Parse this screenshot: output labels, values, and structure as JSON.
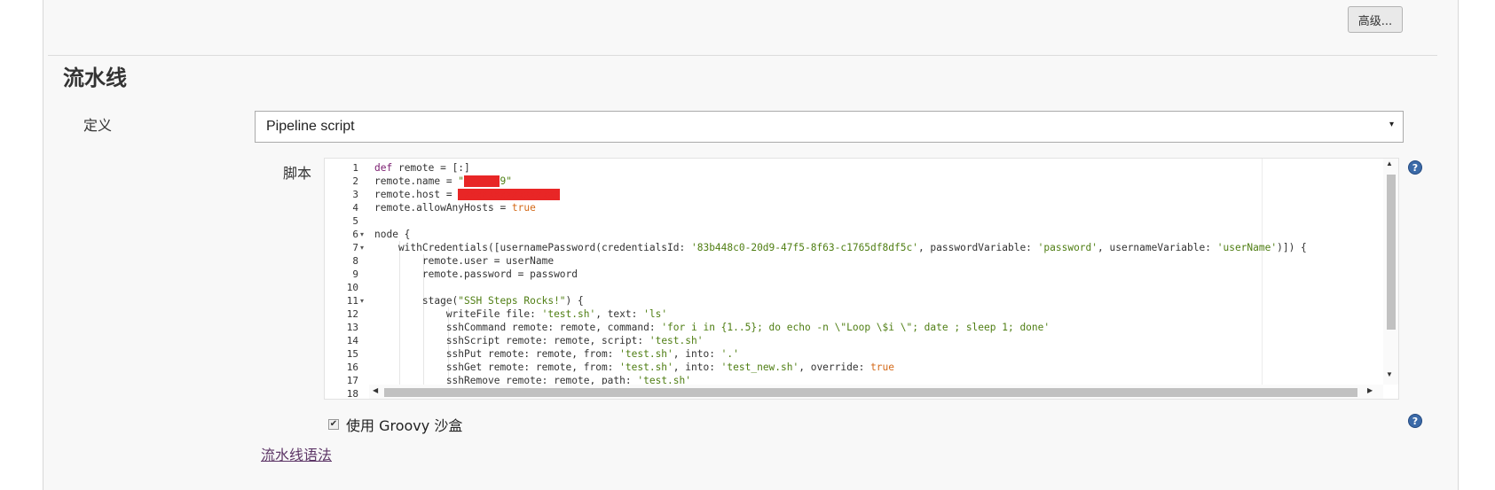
{
  "advanced_button": "高级...",
  "section": {
    "title": "流水线"
  },
  "definition": {
    "label": "定义",
    "selected": "Pipeline script",
    "arrow": "▾"
  },
  "script": {
    "label": "脚本",
    "line_numbers": [
      "1",
      "2",
      "3",
      "4",
      "5",
      "6",
      "7",
      "8",
      "9",
      "10",
      "11",
      "12",
      "13",
      "14",
      "15",
      "16",
      "17",
      "18"
    ],
    "folds": {
      "6": "▾",
      "7": "▾",
      "11": "▾"
    },
    "code": [
      [
        {
          "t": "def",
          "c": "kw"
        },
        {
          "t": " remote = [:]",
          "c": "op"
        }
      ],
      [
        {
          "t": "remote.name = ",
          "c": "op"
        },
        {
          "t": "\"",
          "c": "str"
        },
        {
          "t": "xxxxxx",
          "c": "red"
        },
        {
          "t": "9\"",
          "c": "str"
        }
      ],
      [
        {
          "t": "remote.host = ",
          "c": "op"
        },
        {
          "t": "'xxxxxxxxxxxxxxx'",
          "c": "red"
        }
      ],
      [
        {
          "t": "remote.allowAnyHosts = ",
          "c": "op"
        },
        {
          "t": "true",
          "c": "bool"
        }
      ],
      [],
      [
        {
          "t": "node {",
          "c": "op"
        }
      ],
      [
        {
          "t": "    withCredentials([usernamePassword(credentialsId: ",
          "c": "op"
        },
        {
          "t": "'83b448c0-20d9-47f5-8f63-c1765df8df5c'",
          "c": "str"
        },
        {
          "t": ", passwordVariable: ",
          "c": "op"
        },
        {
          "t": "'password'",
          "c": "str"
        },
        {
          "t": ", usernameVariable: ",
          "c": "op"
        },
        {
          "t": "'userName'",
          "c": "str"
        },
        {
          "t": ")]) {",
          "c": "op"
        }
      ],
      [
        {
          "t": "        remote.user = userName",
          "c": "op"
        }
      ],
      [
        {
          "t": "        remote.password = password",
          "c": "op"
        }
      ],
      [],
      [
        {
          "t": "        stage(",
          "c": "op"
        },
        {
          "t": "\"SSH Steps Rocks!\"",
          "c": "str"
        },
        {
          "t": ") {",
          "c": "op"
        }
      ],
      [
        {
          "t": "            writeFile file: ",
          "c": "op"
        },
        {
          "t": "'test.sh'",
          "c": "str"
        },
        {
          "t": ", text: ",
          "c": "op"
        },
        {
          "t": "'ls'",
          "c": "str"
        }
      ],
      [
        {
          "t": "            sshCommand remote: remote, command: ",
          "c": "op"
        },
        {
          "t": "'for i in {1..5}; do echo -n \\\"Loop \\$i \\\"; date ; sleep 1; done'",
          "c": "str"
        }
      ],
      [
        {
          "t": "            sshScript remote: remote, script: ",
          "c": "op"
        },
        {
          "t": "'test.sh'",
          "c": "str"
        }
      ],
      [
        {
          "t": "            sshPut remote: remote, from: ",
          "c": "op"
        },
        {
          "t": "'test.sh'",
          "c": "str"
        },
        {
          "t": ", into: ",
          "c": "op"
        },
        {
          "t": "'.'",
          "c": "str"
        }
      ],
      [
        {
          "t": "            sshGet remote: remote, from: ",
          "c": "op"
        },
        {
          "t": "'test.sh'",
          "c": "str"
        },
        {
          "t": ", into: ",
          "c": "op"
        },
        {
          "t": "'test_new.sh'",
          "c": "str"
        },
        {
          "t": ", override: ",
          "c": "op"
        },
        {
          "t": "true",
          "c": "bool"
        }
      ],
      [
        {
          "t": "            sshRemove remote: remote, path: ",
          "c": "op"
        },
        {
          "t": "'test.sh'",
          "c": "str"
        }
      ],
      []
    ]
  },
  "sandbox": {
    "label": "使用 Groovy 沙盒",
    "checked": true,
    "checkmark": "✔"
  },
  "syntax_link": "流水线语法",
  "help_icon_glyph": "?",
  "scroll_glyphs": {
    "up": "▲",
    "down": "▼",
    "left": "◀",
    "right": "▶"
  }
}
